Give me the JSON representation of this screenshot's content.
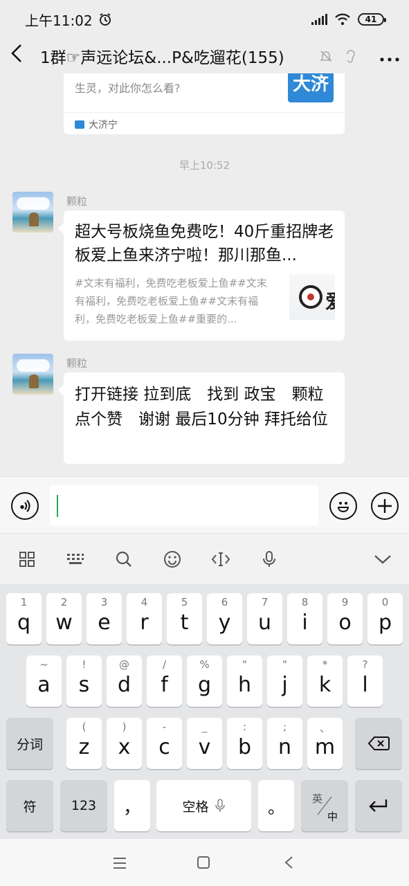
{
  "status_bar": {
    "time": "上午11:02",
    "battery": "41"
  },
  "header": {
    "title": "1群☞声远论坛&...P&吃遛花(155)"
  },
  "top_card": {
    "description": "生灵，对此你怎么看?",
    "thumb_text": "大济",
    "source": "大济宁"
  },
  "timestamp": "早上10:52",
  "messages": [
    {
      "sender": "颗粒",
      "type": "link",
      "title": "超大号板烧鱼免费吃！40斤重招牌老板爱上鱼来济宁啦！那川那鱼...",
      "description": "#文末有福利，免费吃老板爱上鱼##文末有福利，免费吃老板爱上鱼##文末有福利，免费吃老板爱上鱼##重要的..."
    },
    {
      "sender": "颗粒",
      "type": "text",
      "text": "打开链接 拉到底　找到 政宝　颗粒　点个赞　谢谢 最后10分钟 拜托给位"
    }
  ],
  "keyboard": {
    "row1": [
      {
        "hint": "1",
        "key": "q"
      },
      {
        "hint": "2",
        "key": "w"
      },
      {
        "hint": "3",
        "key": "e"
      },
      {
        "hint": "4",
        "key": "r"
      },
      {
        "hint": "5",
        "key": "t"
      },
      {
        "hint": "6",
        "key": "y"
      },
      {
        "hint": "7",
        "key": "u"
      },
      {
        "hint": "8",
        "key": "i"
      },
      {
        "hint": "9",
        "key": "o"
      },
      {
        "hint": "0",
        "key": "p"
      }
    ],
    "row2": [
      {
        "hint": "~",
        "key": "a"
      },
      {
        "hint": "!",
        "key": "s"
      },
      {
        "hint": "@",
        "key": "d"
      },
      {
        "hint": "/",
        "key": "f"
      },
      {
        "hint": "%",
        "key": "g"
      },
      {
        "hint": "\"",
        "key": "h"
      },
      {
        "hint": "\"",
        "key": "j"
      },
      {
        "hint": "*",
        "key": "k"
      },
      {
        "hint": "?",
        "key": "l"
      }
    ],
    "row3": [
      {
        "hint": "(",
        "key": "z"
      },
      {
        "hint": ")",
        "key": "x"
      },
      {
        "hint": "-",
        "key": "c"
      },
      {
        "hint": "_",
        "key": "v"
      },
      {
        "hint": ":",
        "key": "b"
      },
      {
        "hint": ";",
        "key": "n"
      },
      {
        "hint": "、",
        "key": "m"
      }
    ],
    "fenci": "分词",
    "fu": "符",
    "num": "123",
    "comma": "，",
    "space": "空格",
    "period": "。",
    "lang_top": "英",
    "lang_bottom": "中"
  }
}
